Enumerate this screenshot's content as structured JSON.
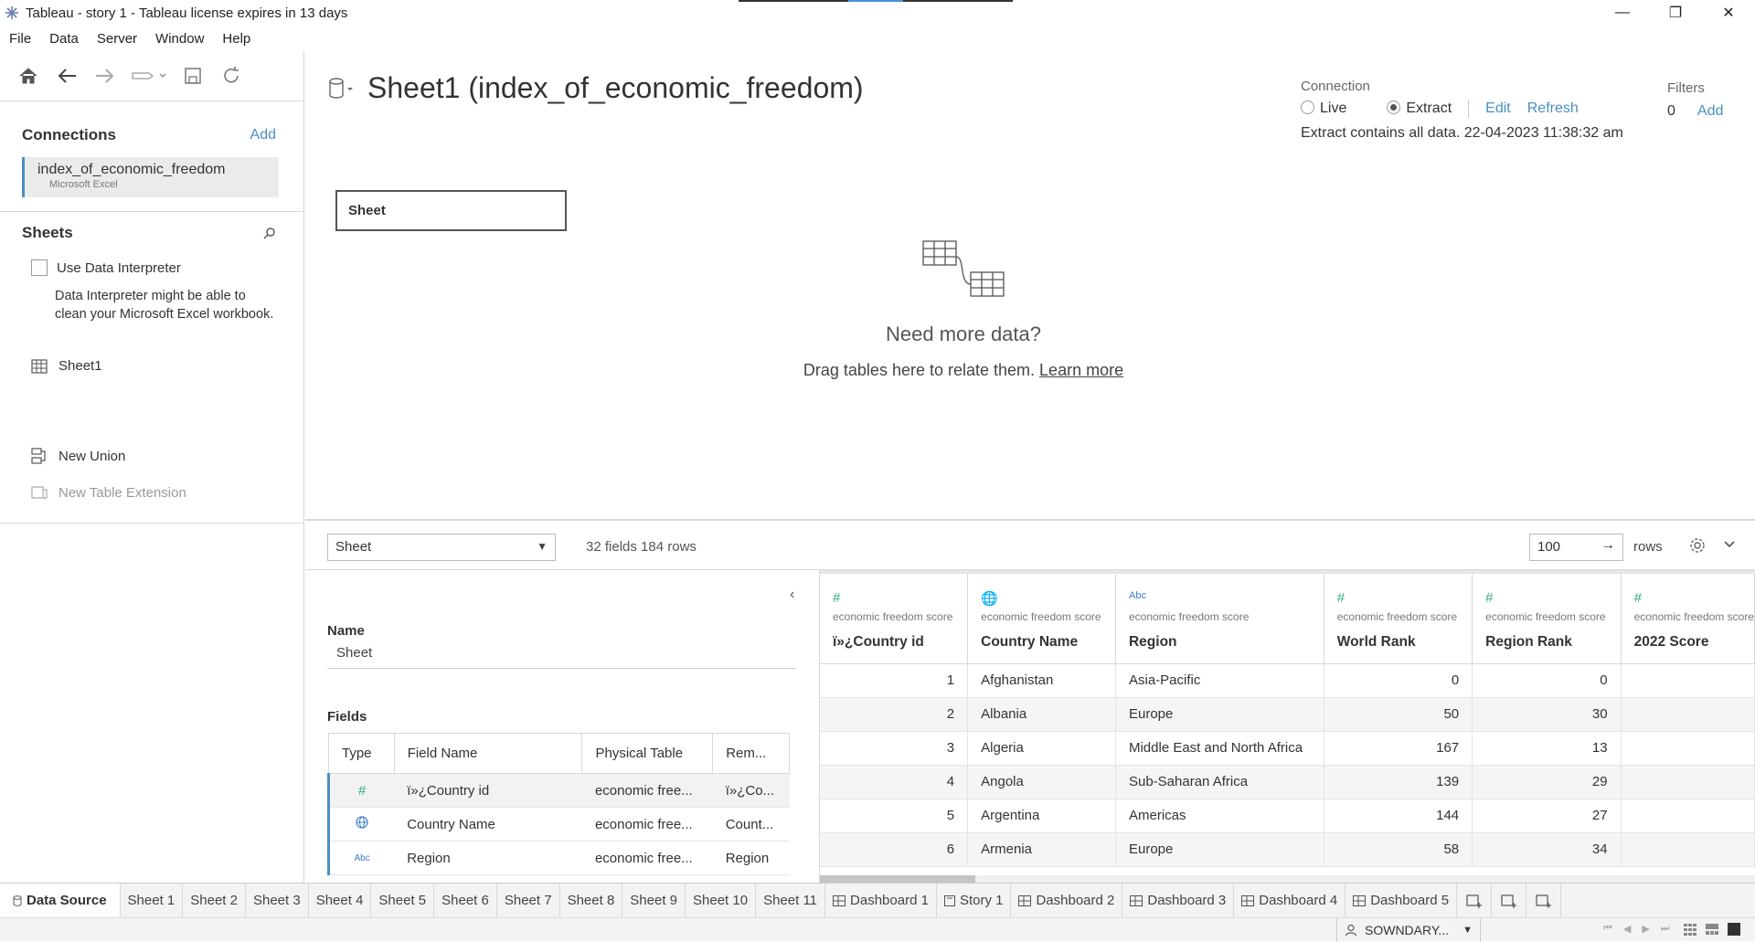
{
  "window": {
    "title": "Tableau - story 1 - Tableau license expires in 13 days",
    "minimize": "—",
    "restore": "❐",
    "close": "✕"
  },
  "menu": [
    "File",
    "Data",
    "Server",
    "Window",
    "Help"
  ],
  "left": {
    "connections_title": "Connections",
    "add_label": "Add",
    "connection": {
      "name": "index_of_economic_freedom",
      "type": "Microsoft Excel"
    },
    "sheets_title": "Sheets",
    "use_interpreter": "Use Data Interpreter",
    "interpreter_note": "Data Interpreter might be able to clean your Microsoft Excel workbook.",
    "sheet_item": "Sheet1",
    "new_union": "New Union",
    "new_table_extension": "New Table Extension"
  },
  "canvas": {
    "title": "Sheet1 (index_of_economic_freedom)",
    "connection_label": "Connection",
    "live": "Live",
    "extract": "Extract",
    "edit": "Edit",
    "refresh": "Refresh",
    "extract_note": "Extract contains all data. 22-04-2023 11:38:32 am",
    "filters_label": "Filters",
    "filters_count": "0",
    "filters_add": "Add",
    "table_pill": "Sheet",
    "empty_title": "Need more data?",
    "empty_sub": "Drag tables here to relate them.",
    "learn_more": "Learn more"
  },
  "lower": {
    "table_select": "Sheet",
    "fields_count": "32 fields 184 rows",
    "rows_value": "100",
    "rows_label": "rows"
  },
  "meta": {
    "name_label": "Name",
    "name_value": "Sheet",
    "fields_label": "Fields",
    "headers": [
      "Type",
      "Field Name",
      "Physical Table",
      "Rem..."
    ],
    "rows": [
      {
        "type": "#",
        "field": "ï»¿Country id",
        "table": "economic free...",
        "remote": "ï»¿Co..."
      },
      {
        "type": "globe",
        "field": "Country Name",
        "table": "economic free...",
        "remote": "Count..."
      },
      {
        "type": "Abc",
        "field": "Region",
        "table": "economic free...",
        "remote": "Region"
      }
    ]
  },
  "grid": {
    "columns": [
      {
        "icon": "#",
        "source": "economic freedom score",
        "name": "ï»¿Country id"
      },
      {
        "icon": "🌐",
        "source": "economic freedom score",
        "name": "Country Name"
      },
      {
        "icon": "Abc",
        "source": "economic freedom score",
        "name": "Region"
      },
      {
        "icon": "#",
        "source": "economic freedom score",
        "name": "World Rank"
      },
      {
        "icon": "#",
        "source": "economic freedom score",
        "name": "Region Rank"
      },
      {
        "icon": "#",
        "source": "economic freedom score",
        "name": "2022 Score"
      }
    ],
    "rows": [
      [
        "1",
        "Afghanistan",
        "Asia-Pacific",
        "0",
        "0",
        ""
      ],
      [
        "2",
        "Albania",
        "Europe",
        "50",
        "30",
        ""
      ],
      [
        "3",
        "Algeria",
        "Middle East and North Africa",
        "167",
        "13",
        ""
      ],
      [
        "4",
        "Angola",
        "Sub-Saharan Africa",
        "139",
        "29",
        ""
      ],
      [
        "5",
        "Argentina",
        "Americas",
        "144",
        "27",
        ""
      ],
      [
        "6",
        "Armenia",
        "Europe",
        "58",
        "34",
        ""
      ]
    ]
  },
  "tabs": {
    "data_source": "Data Source",
    "sheets": [
      "Sheet 1",
      "Sheet 2",
      "Sheet 3",
      "Sheet 4",
      "Sheet 5",
      "Sheet 6",
      "Sheet 7",
      "Sheet 8",
      "Sheet 9",
      "Sheet 10",
      "Sheet 11"
    ],
    "dashboards_a": [
      "Dashboard 1"
    ],
    "story": "Story 1",
    "dashboards_b": [
      "Dashboard 2",
      "Dashboard 3",
      "Dashboard 4",
      "Dashboard 5"
    ]
  },
  "status": {
    "user": "SOWNDARY..."
  },
  "colors": {
    "accent": "#4a90c2",
    "measure_icon": "#2eaa8a"
  }
}
